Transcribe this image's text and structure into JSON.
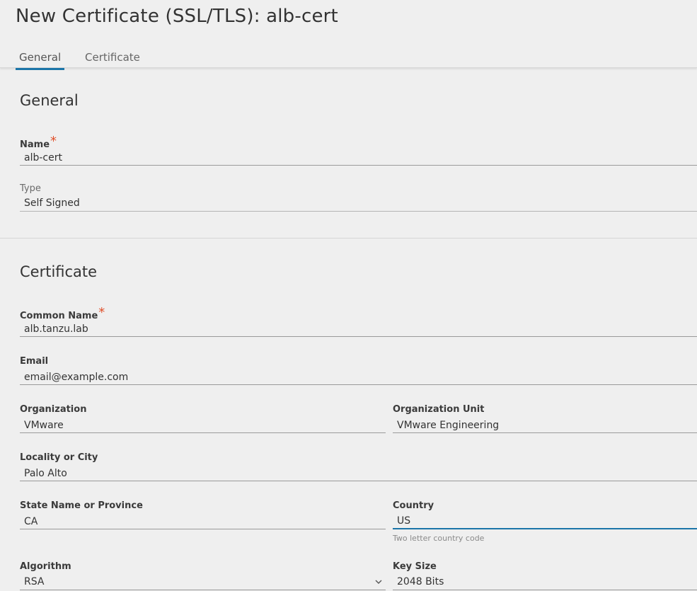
{
  "page": {
    "title": "New Certificate (SSL/TLS): alb-cert"
  },
  "tabs": [
    {
      "label": "General",
      "active": true
    },
    {
      "label": "Certificate",
      "active": false
    }
  ],
  "general": {
    "section_title": "General",
    "name": {
      "label": "Name",
      "value": "alb-cert",
      "required": true
    },
    "type": {
      "label": "Type",
      "value": "Self Signed"
    }
  },
  "certificate": {
    "section_title": "Certificate",
    "common_name": {
      "label": "Common Name",
      "value": "alb.tanzu.lab",
      "required": true
    },
    "email": {
      "label": "Email",
      "value": "email@example.com"
    },
    "organization": {
      "label": "Organization",
      "value": "VMware"
    },
    "organization_unit": {
      "label": "Organization Unit",
      "value": "VMware Engineering"
    },
    "locality": {
      "label": "Locality or City",
      "value": "Palo Alto"
    },
    "state": {
      "label": "State Name or Province",
      "value": "CA"
    },
    "country": {
      "label": "Country",
      "value": "US",
      "helper": "Two letter country code"
    },
    "algorithm": {
      "label": "Algorithm",
      "value": "RSA"
    },
    "key_size": {
      "label": "Key Size",
      "value": "2048 Bits"
    }
  },
  "required_marker": "*",
  "colors": {
    "accent": "#1b75a8",
    "required": "#e0502b",
    "background": "#efefef"
  },
  "icons": {
    "algorithm_dropdown": "chevron-down-icon"
  }
}
